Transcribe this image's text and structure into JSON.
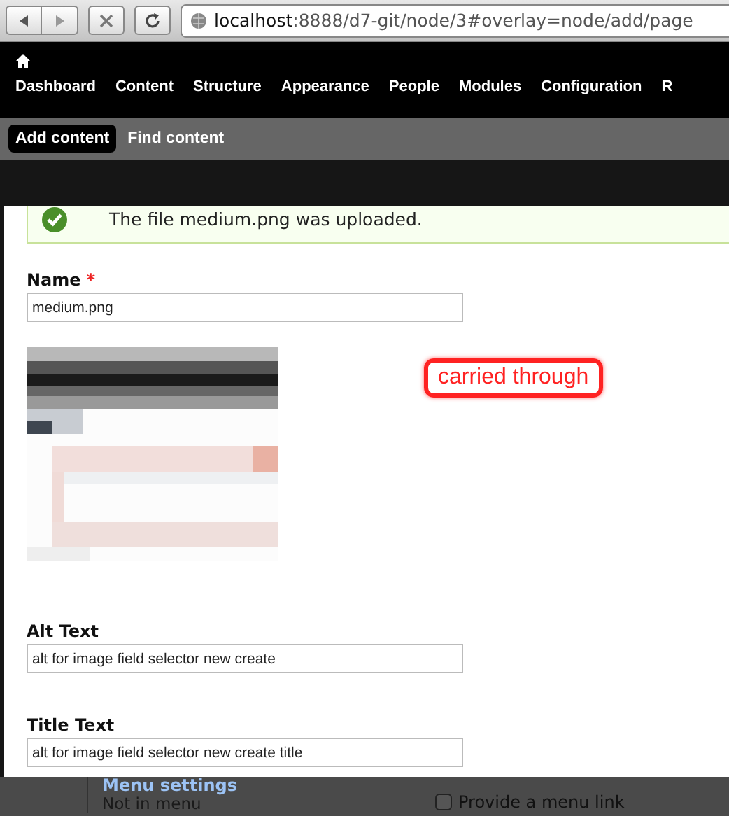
{
  "browser": {
    "url_host": "localhost",
    "url_rest": ":8888/d7-git/node/3#overlay=node/add/page"
  },
  "toolbar": {
    "menu": [
      "Dashboard",
      "Content",
      "Structure",
      "Appearance",
      "People",
      "Modules",
      "Configuration",
      "R"
    ]
  },
  "shortcuts": [
    {
      "label": "Add content",
      "selected": true
    },
    {
      "label": "Find content",
      "selected": false
    }
  ],
  "dialog": {
    "message": {
      "kind": "status",
      "text": "The file medium.png was uploaded."
    },
    "fields": [
      {
        "label": "Name",
        "required_mark": "*",
        "value": "medium.png"
      },
      {
        "kind": "picture"
      },
      {
        "label": "Alt Text",
        "value": "alt for image field selector new create"
      },
      {
        "label": "Title Text",
        "value": "alt for image field selector new create title"
      }
    ],
    "annotation": "carried through"
  },
  "menu_settings": {
    "title": "Menu settings",
    "summary": "Not in menu",
    "checkbox": {
      "label": "Provide a menu link",
      "checked": false
    }
  }
}
